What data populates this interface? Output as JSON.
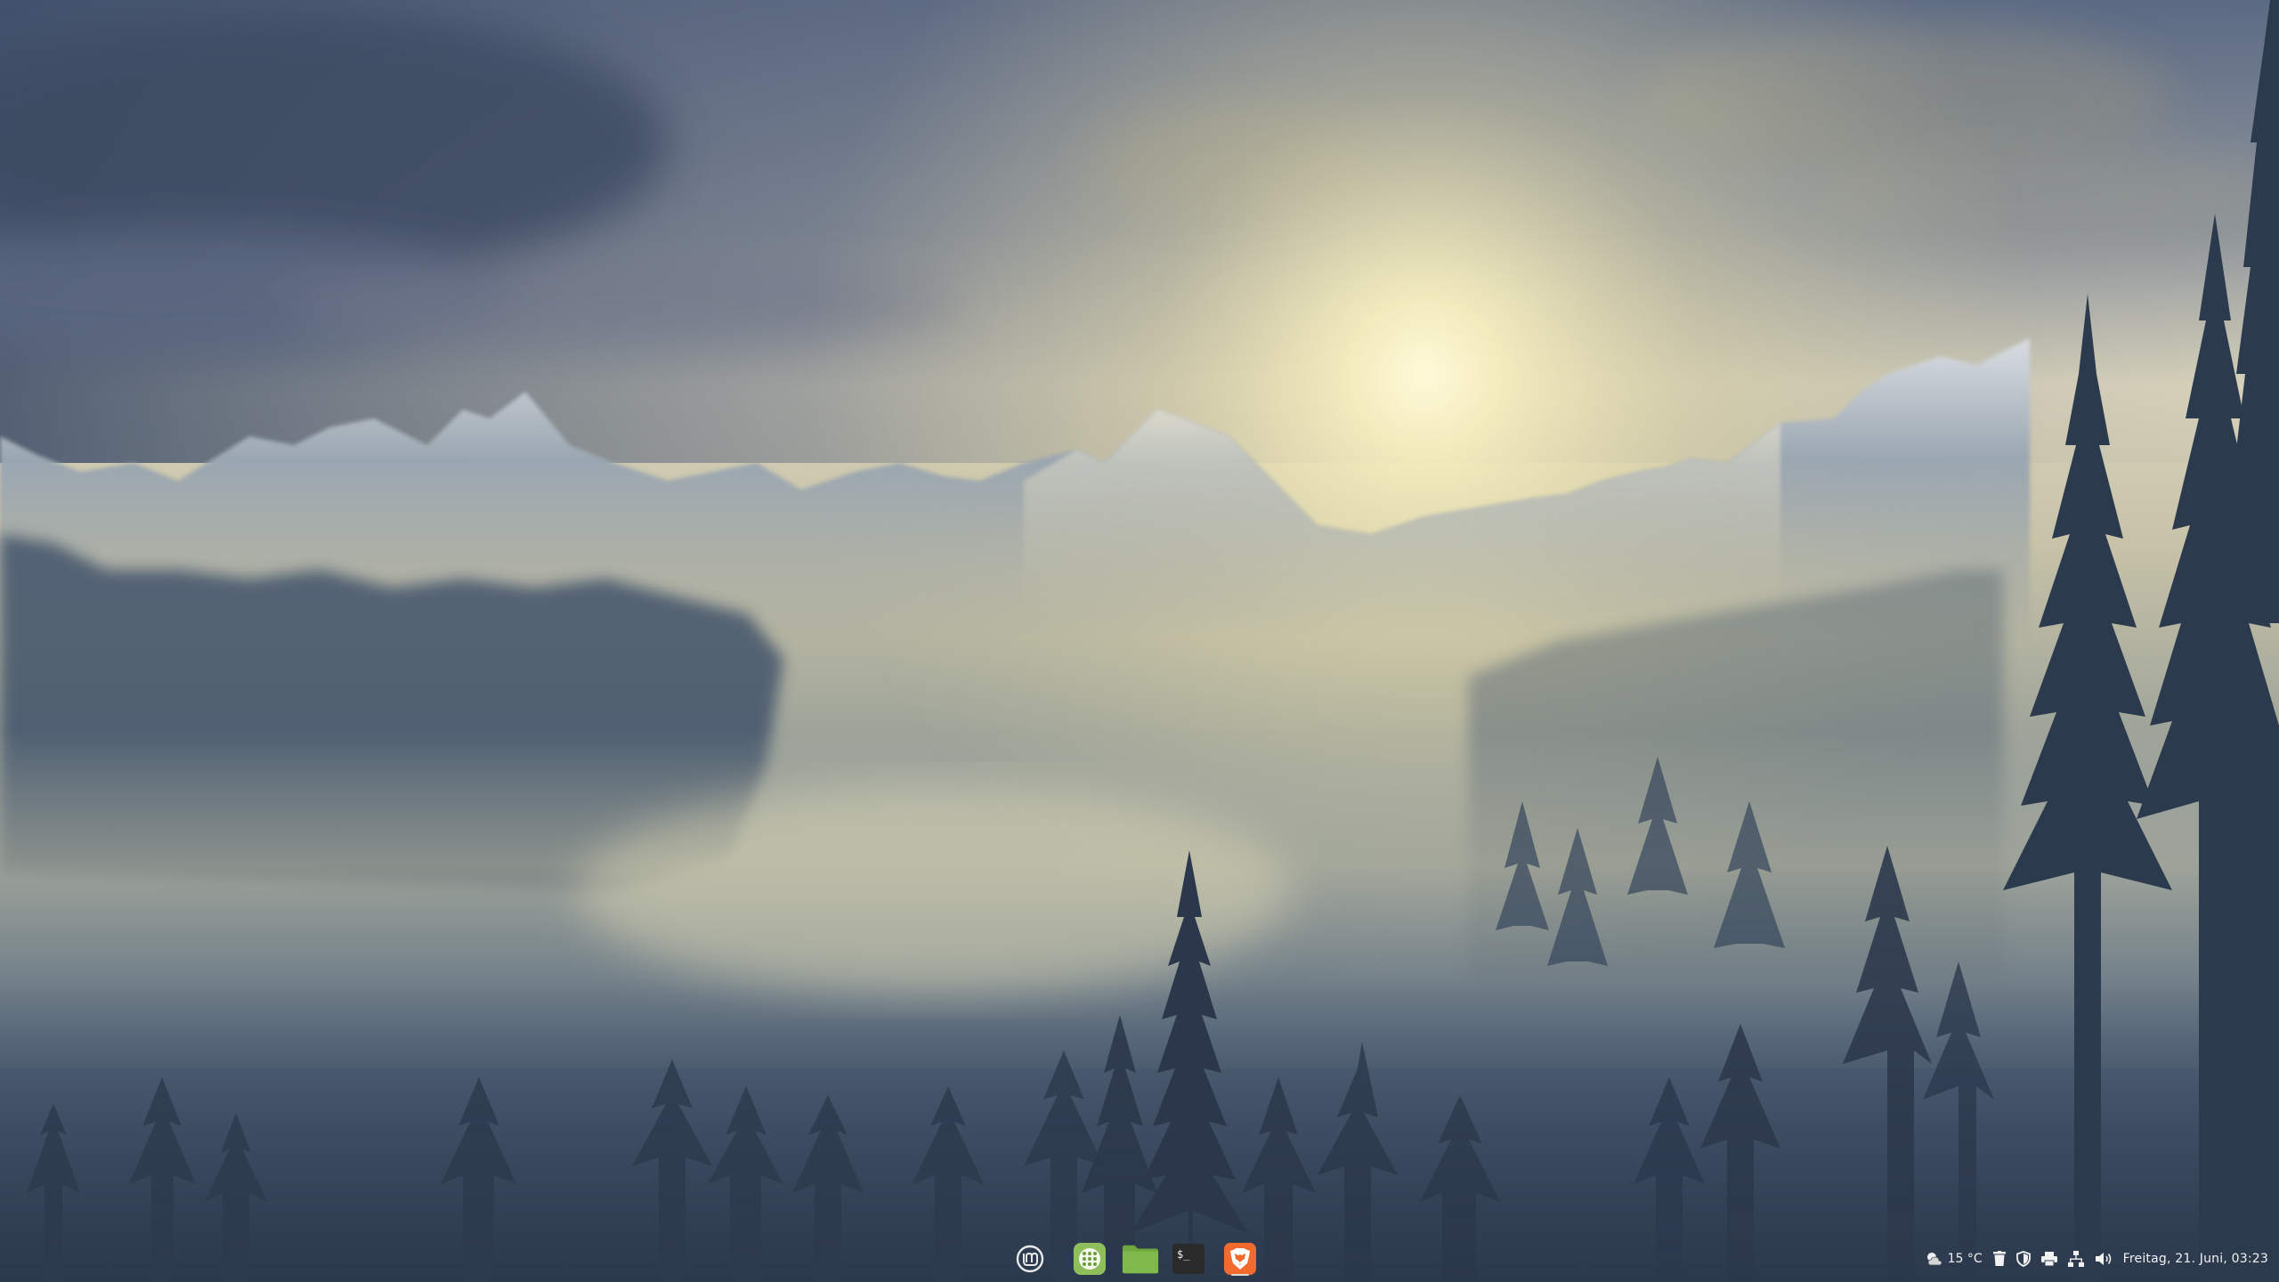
{
  "desktop": {
    "wallpaper": "misty-mountain-forest-sunrise"
  },
  "panel": {
    "launchers": [
      {
        "name": "menu",
        "icon": "linux-mint-logo-icon"
      },
      {
        "name": "software-manager",
        "icon": "app-grid-icon"
      },
      {
        "name": "files",
        "icon": "folder-icon"
      },
      {
        "name": "terminal",
        "icon": "terminal-icon",
        "glyph": "$_"
      },
      {
        "name": "brave-browser",
        "icon": "brave-lion-icon",
        "active": true
      }
    ],
    "tray": {
      "weather": {
        "icon": "weather-partly-cloudy-icon",
        "temperature": "15 °C"
      },
      "icons": [
        "trash-icon",
        "shield-icon",
        "printer-icon",
        "network-icon",
        "volume-icon"
      ],
      "clock": "Freitag, 21. Juni, 03:23"
    }
  },
  "colors": {
    "folder": "#7fb84b",
    "software_manager": "#8fbf5a",
    "brave": "#f26a2e",
    "terminal": "#2a2a2a",
    "tray_text": "#f2f2f2"
  }
}
